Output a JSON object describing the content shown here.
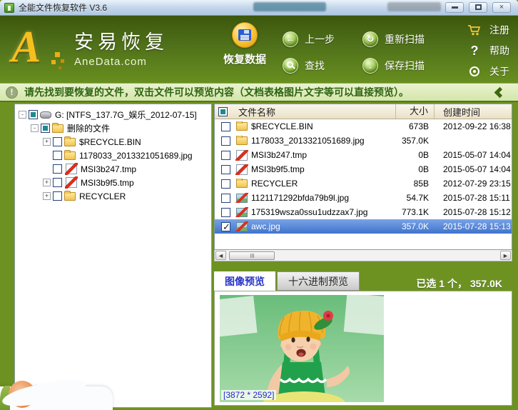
{
  "titlebar": {
    "title": "全能文件恢复软件 V3.6"
  },
  "header": {
    "logo_letter": "A",
    "logo_name": "安易恢复",
    "logo_site": "AneData.com",
    "recover": {
      "label": "恢复数据"
    },
    "nav": [
      {
        "label": "上一步",
        "icon": "arrow-left"
      },
      {
        "label": "重新扫描",
        "icon": "refresh"
      },
      {
        "label": "查找",
        "icon": "search"
      },
      {
        "label": "保存扫描",
        "icon": "save"
      }
    ],
    "menu": [
      {
        "label": "注册",
        "icon": "cart"
      },
      {
        "label": "帮助",
        "icon": "question"
      },
      {
        "label": "关于",
        "icon": "about"
      }
    ]
  },
  "infobar": {
    "text": "请先找到要恢复的文件，双击文件可以预览内容（文档表格图片文字等可以直接预览）。"
  },
  "tree": {
    "items": [
      {
        "level": 0,
        "expander": "minus",
        "check": "solid",
        "icon": "drive",
        "label": "G: [NTFS_137.7G_娱乐_2012-07-15]"
      },
      {
        "level": 1,
        "expander": "minus",
        "check": "solid",
        "icon": "folder-open",
        "label": "删除的文件"
      },
      {
        "level": 2,
        "expander": "plus",
        "check": "empty",
        "icon": "folder",
        "label": "$RECYCLE.BIN"
      },
      {
        "level": 2,
        "expander": "none",
        "check": "empty",
        "icon": "folder",
        "label": "1178033_2013321051689.jpg"
      },
      {
        "level": 2,
        "expander": "none",
        "check": "empty",
        "icon": "file-del",
        "label": "MSI3b247.tmp"
      },
      {
        "level": 2,
        "expander": "plus",
        "check": "empty",
        "icon": "file-del",
        "label": "MSI3b9f5.tmp"
      },
      {
        "level": 2,
        "expander": "plus",
        "check": "empty",
        "icon": "folder",
        "label": "RECYCLER"
      }
    ]
  },
  "file_list": {
    "columns": [
      "文件名称",
      "大小",
      "创建时间"
    ],
    "rows": [
      {
        "checked": false,
        "selected": false,
        "icon": "folder",
        "name": "$RECYCLE.BIN",
        "size": "673B",
        "time": "2012-09-22 16:38"
      },
      {
        "checked": false,
        "selected": false,
        "icon": "folder",
        "name": "1178033_2013321051689.jpg",
        "size": "357.0K",
        "time": ""
      },
      {
        "checked": false,
        "selected": false,
        "icon": "file-del",
        "name": "MSI3b247.tmp",
        "size": "0B",
        "time": "2015-05-07 14:04"
      },
      {
        "checked": false,
        "selected": false,
        "icon": "file-del",
        "name": "MSI3b9f5.tmp",
        "size": "0B",
        "time": "2015-05-07 14:04"
      },
      {
        "checked": false,
        "selected": false,
        "icon": "folder",
        "name": "RECYCLER",
        "size": "85B",
        "time": "2012-07-29 23:15"
      },
      {
        "checked": false,
        "selected": false,
        "icon": "image-del",
        "name": "1121171292bfda79b9l.jpg",
        "size": "54.7K",
        "time": "2015-07-28 15:11"
      },
      {
        "checked": false,
        "selected": false,
        "icon": "image-del",
        "name": "175319wsza0ssu1udzzax7.jpg",
        "size": "773.1K",
        "time": "2015-07-28 15:12"
      },
      {
        "checked": true,
        "selected": true,
        "icon": "image-del",
        "name": "awc.jpg",
        "size": "357.0K",
        "time": "2015-07-28 15:13"
      }
    ]
  },
  "preview": {
    "tabs": [
      {
        "label": "图像预览",
        "active": true
      },
      {
        "label": "十六进制预览",
        "active": false
      }
    ],
    "selection_summary": "已选 1 个， 357.0K",
    "image_caption": "[3872 * 2592]"
  },
  "colors": {
    "header_green": "#50711a",
    "accent_gold": "#f5c01e",
    "selected_row_blue": "#3f73cd",
    "info_text_green": "#2e6413",
    "active_tab_text": "#2836c8"
  }
}
